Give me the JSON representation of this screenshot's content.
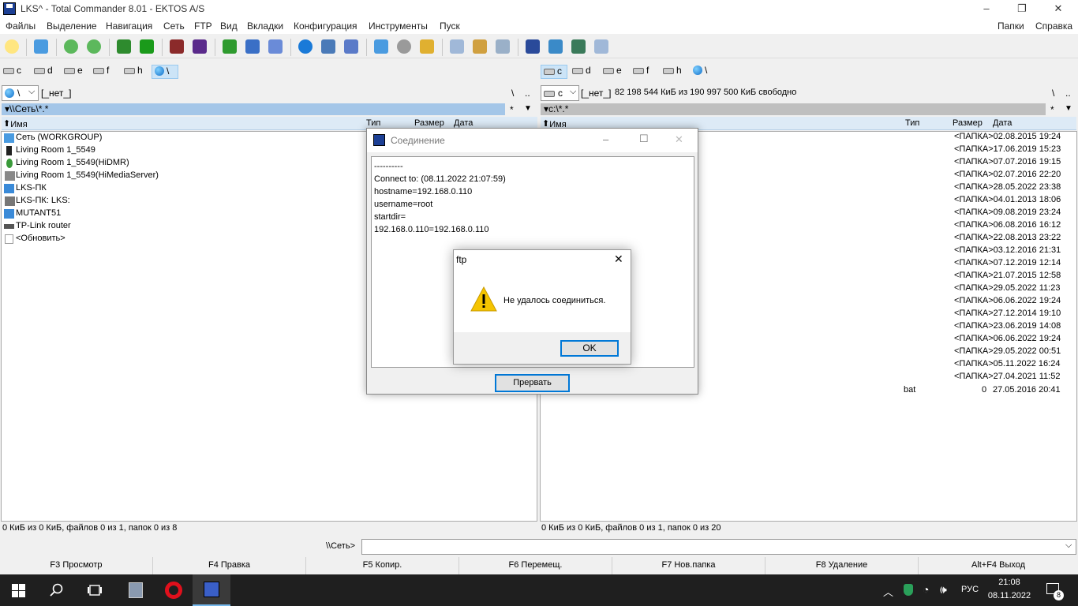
{
  "window": {
    "title": "LKS^ - Total Commander 8.01 - EKTOS A/S",
    "minimize": "–",
    "restore": "❐",
    "close": "✕"
  },
  "menu": {
    "items": [
      "Файлы",
      "Выделение",
      "Навигация",
      "Сеть",
      "FTP",
      "Вид",
      "Вкладки",
      "Конфигурация",
      "Инструменты",
      "Пуск"
    ],
    "right": [
      "Папки",
      "Справка"
    ]
  },
  "drives": {
    "left": [
      "c",
      "d",
      "e",
      "f",
      "h",
      "\\"
    ],
    "right": [
      "c",
      "d",
      "e",
      "f",
      "h",
      "\\"
    ]
  },
  "left_panel": {
    "combo_value": "\\",
    "volume_label": "[_нет_]",
    "root_btn": "\\",
    "up_btn": "..",
    "path": "\\\\Сеть\\*.*",
    "filter_btn": "*",
    "columns": [
      "Имя",
      "Тип",
      "Размер",
      "Дата"
    ],
    "files": [
      "Сеть (WORKGROUP)",
      "Living Room 1_5549",
      "Living Room 1_5549(HiDMR)",
      "Living Room 1_5549(HiMediaServer)",
      "LKS-ПК",
      "LKS-ПК: LKS:",
      "MUTANT51",
      "TP-Link router",
      "<Обновить>"
    ],
    "status": "0 КиБ из 0 КиБ, файлов 0 из 1, папок 0 из 8"
  },
  "right_panel": {
    "combo_value": "c",
    "volume_label": "[_нет_]",
    "free_space": "82 198 544 КиБ из 190 997 500 КиБ свободно",
    "root_btn": "\\",
    "up_btn": "..",
    "path": "c:\\*.*",
    "filter_btn": "*",
    "columns": [
      "Имя",
      "Тип",
      "Размер",
      "Дата"
    ],
    "rows": [
      {
        "size": "<ПАПКА>",
        "date": "02.08.2015 19:24"
      },
      {
        "size": "<ПАПКА>",
        "date": "17.06.2019 15:23"
      },
      {
        "size": "<ПАПКА>",
        "date": "07.07.2016 19:15"
      },
      {
        "size": "<ПАПКА>",
        "date": "02.07.2016 22:20"
      },
      {
        "size": "<ПАПКА>",
        "date": "28.05.2022 23:38"
      },
      {
        "size": "<ПАПКА>",
        "date": "04.01.2013 18:06"
      },
      {
        "size": "<ПАПКА>",
        "date": "09.08.2019 23:24"
      },
      {
        "size": "<ПАПКА>",
        "date": "06.08.2016 16:12"
      },
      {
        "size": "<ПАПКА>",
        "date": "22.08.2013 23:22"
      },
      {
        "size": "<ПАПКА>",
        "date": "03.12.2016 21:31"
      },
      {
        "size": "<ПАПКА>",
        "date": "07.12.2019 12:14"
      },
      {
        "size": "<ПАПКА>",
        "date": "21.07.2015 12:58"
      },
      {
        "size": "<ПАПКА>",
        "date": "29.05.2022 11:23"
      },
      {
        "size": "<ПАПКА>",
        "date": "06.06.2022 19:24"
      },
      {
        "size": "<ПАПКА>",
        "date": "27.12.2014 19:10"
      },
      {
        "size": "<ПАПКА>",
        "date": "23.06.2019 14:08"
      },
      {
        "size": "<ПАПКА>",
        "date": "06.06.2022 19:24"
      },
      {
        "size": "<ПАПКА>",
        "date": "29.05.2022 00:51"
      },
      {
        "size": "<ПАПКА>",
        "date": "05.11.2022 16:24"
      },
      {
        "size": "<ПАПКА>",
        "date": "27.04.2021 11:52"
      }
    ],
    "last_file": {
      "type": "bat",
      "size": "0",
      "date": "27.05.2016 20:41"
    },
    "status": "0 КиБ из 0 КиБ, файлов 0 из 1, папок 0 из 20"
  },
  "cmdline": {
    "prompt": "\\\\Сеть>",
    "value": ""
  },
  "fkeys": [
    "F3 Просмотр",
    "F4 Правка",
    "F5 Копир.",
    "F6 Перемещ.",
    "F7 Нов.папка",
    "F8 Удаление",
    "Alt+F4 Выход"
  ],
  "conn_dialog": {
    "title": "Соединение",
    "log": [
      "----------",
      "Connect to: (08.11.2022 21:07:59)",
      "hostname=192.168.0.110",
      "username=root",
      "startdir=",
      "192.168.0.110=192.168.0.110"
    ],
    "abort_label": "Прервать"
  },
  "ftp_dialog": {
    "title": "ftp",
    "message": "Не удалось соединиться.",
    "ok_label": "OK",
    "close": "✕"
  },
  "taskbar": {
    "lang": "РУС",
    "time": "21:08",
    "date": "08.11.2022",
    "notifications": "8"
  },
  "colors": {
    "path_active": "#a4c6e8",
    "accent": "#0078d7",
    "warning": "#f5c400"
  }
}
